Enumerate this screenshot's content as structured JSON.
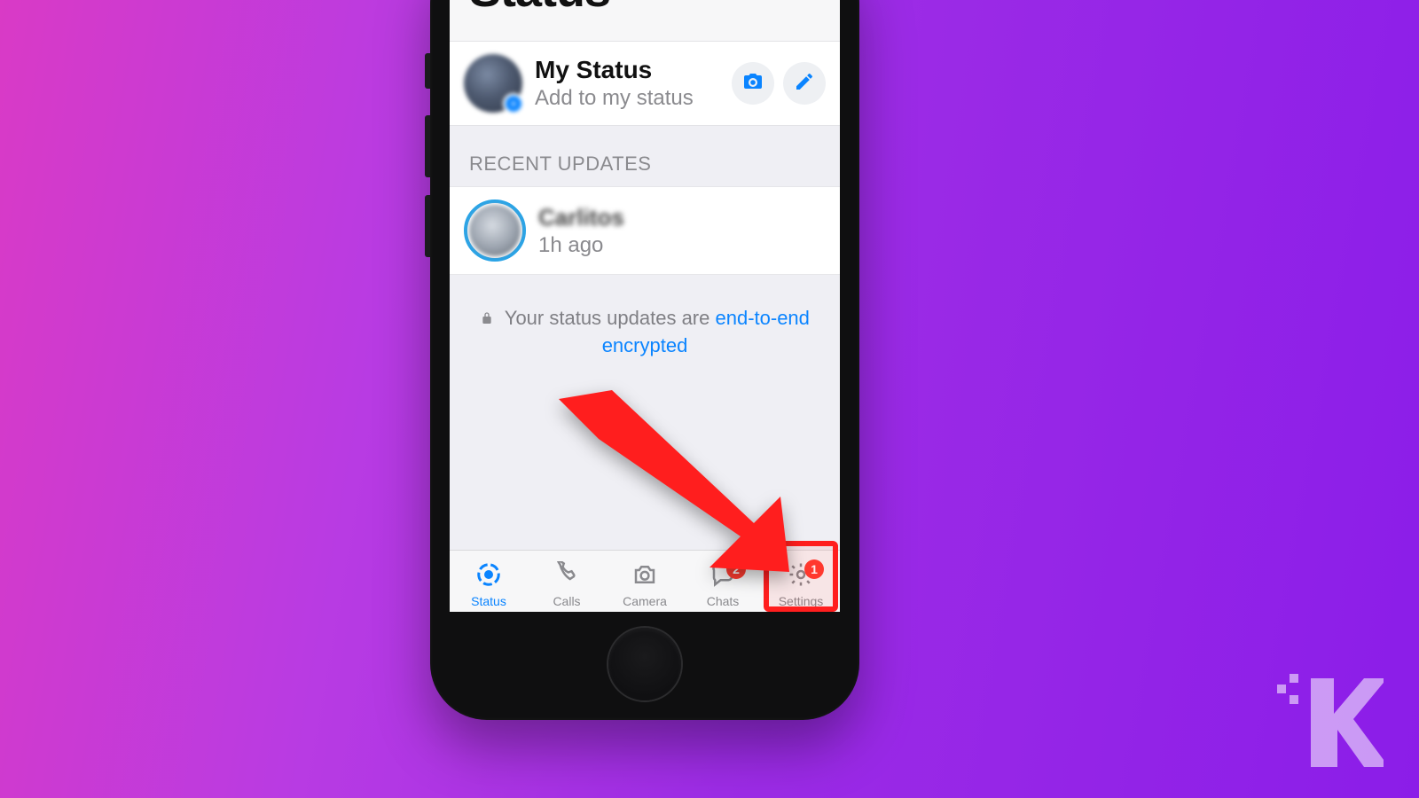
{
  "header": {
    "title": "Status"
  },
  "my_status": {
    "title": "My Status",
    "subtitle": "Add to my status"
  },
  "section_recent": "RECENT UPDATES",
  "recent": {
    "name": "Carlitos",
    "time": "1h ago"
  },
  "note": {
    "prefix": "Your status updates are ",
    "link": "end-to-end encrypted"
  },
  "tabs": {
    "status": {
      "label": "Status"
    },
    "calls": {
      "label": "Calls"
    },
    "camera": {
      "label": "Camera"
    },
    "chats": {
      "label": "Chats",
      "badge": "2"
    },
    "settings": {
      "label": "Settings",
      "badge": "1"
    }
  },
  "colors": {
    "accent": "#0a84ff",
    "badge": "#ff3b30",
    "highlight": "#ff1e1e"
  }
}
